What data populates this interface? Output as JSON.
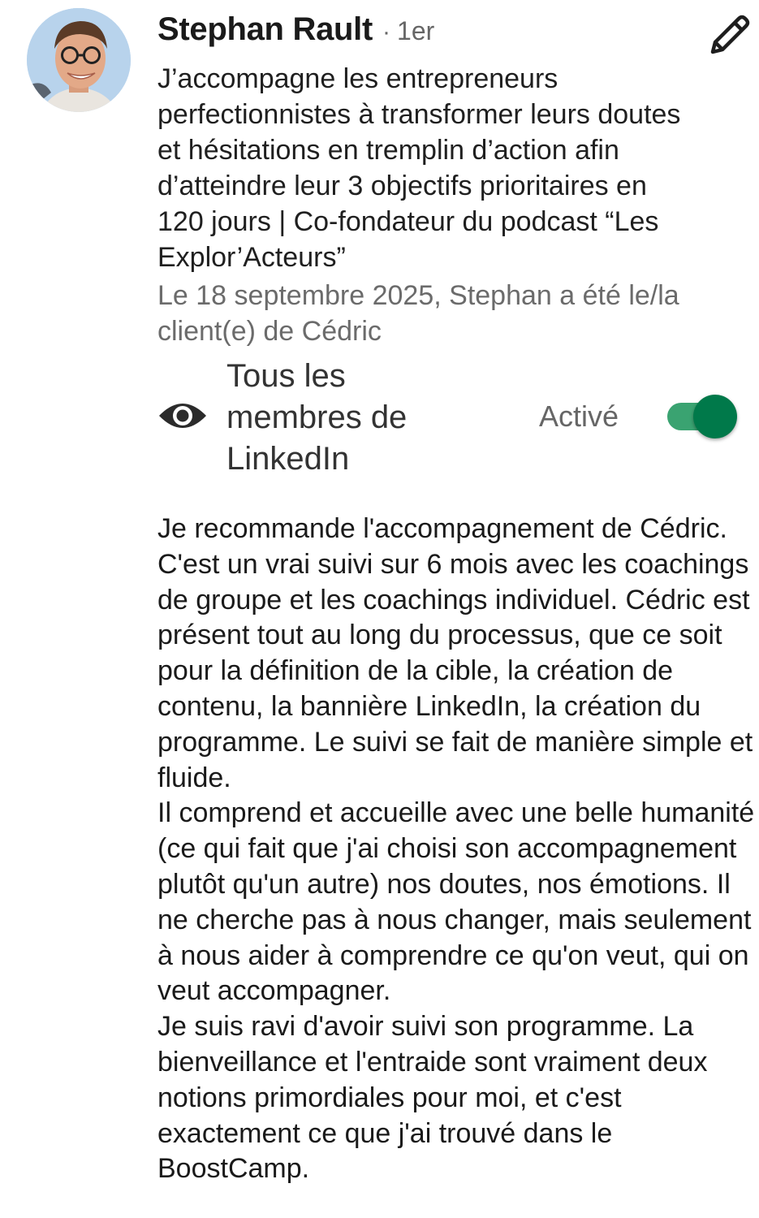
{
  "profile": {
    "name": "Stephan Rault",
    "separator": "·",
    "degree": "1er",
    "headline": "J’accompagne les entrepreneurs perfectionnistes à transformer leurs doutes et hésitations en tremplin d’action afin d’atteindre leur 3 objectifs prioritaires en 120 jours | Co-fondateur du podcast “Les Explor’Acteurs”",
    "relationship": "Le 18 septembre 2025, Stephan a été le/la client(e) de Cédric"
  },
  "visibility": {
    "icon": "eye-icon",
    "label": "Tous les membres de LinkedIn",
    "status": "Activé",
    "enabled": true
  },
  "recommendation": {
    "paragraphs": [
      "Je recommande l'accompagnement de Cédric. C'est un vrai suivi sur 6 mois avec les coachings de groupe et les coachings individuel. Cédric est présent tout au long du processus, que ce soit pour la définition de la cible, la création de contenu, la bannière LinkedIn, la création du programme. Le suivi se fait de manière simple et fluide.",
      "Il comprend et accueille avec une belle humanité (ce qui fait que j'ai choisi son accompagnement plutôt qu'un autre) nos doutes, nos émotions. Il ne cherche pas à nous changer, mais seulement à nous aider à comprendre ce qu'on veut, qui on veut accompagner.",
      "Je suis ravi d'avoir suivi son programme. La bienveillance et l'entraide sont vraiment deux notions primordiales pour moi, et c'est exactement ce que j'ai trouvé dans le BoostCamp."
    ]
  },
  "icons": {
    "edit": "pencil-icon",
    "visibility": "eye-icon"
  },
  "colors": {
    "toggle_track": "#3aa371",
    "toggle_thumb": "#00794a",
    "secondary_text": "#6b6b6b"
  }
}
